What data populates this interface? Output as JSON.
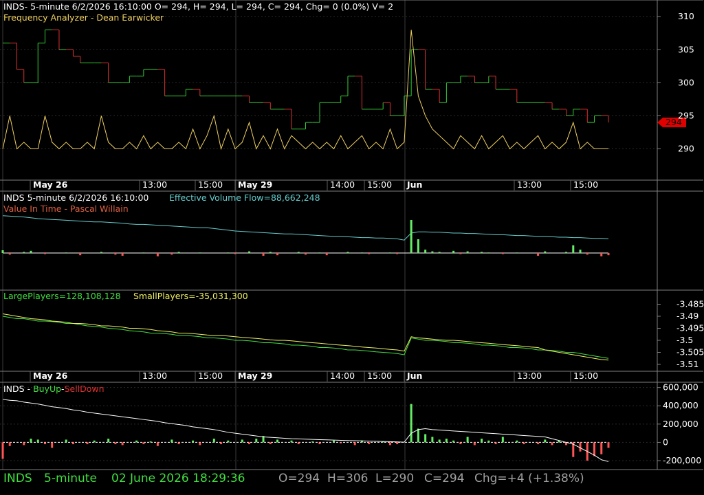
{
  "colors": {
    "bg": "#000000",
    "grid": "#2a2a2a",
    "border": "#808080",
    "text": "#ffffff",
    "up": "#33cc33",
    "down": "#e03030",
    "osc": "#f0d060",
    "cyan": "#66cccc",
    "green": "#40e040",
    "yellow": "#f0f060",
    "white": "#ffffff",
    "red_tag": "#e00000"
  },
  "header": {
    "price_line": "INDS- 5-minute 6/2/2026 16:10:00 O= 294, H= 294, L= 294, C= 294, Chg= 0 (0.0%) V= 2",
    "indicator": "Frequency Analyzer - Dean Earwicker"
  },
  "panel2": {
    "line1": "INDS 5-minute  6/2/2026 16:10:00",
    "evf": "Effective Volume Flow=88,662,248",
    "line2": "Value In Time - Pascal Willain"
  },
  "panel3": {
    "large": "LargePlayers=128,108,128",
    "small": "SmallPlayers=-35,031,300"
  },
  "panel4": {
    "title": "INDS - ",
    "buy": "BuyUp",
    "dash": "-",
    "sell": "SellDown"
  },
  "status": {
    "symbol": "INDS",
    "interval": "5-minute",
    "datetime": "02 June 2026 18:29:36",
    "o": "O=294",
    "h": "H=306",
    "l": "L=290",
    "c": "C=294",
    "chg": "Chg=+4 (+1.38%)"
  },
  "axis": {
    "time_labels": [
      "May 26",
      "13:00",
      "15:00",
      "May 29",
      "14:00",
      "15:00",
      "Jun",
      "13:00",
      "15:00"
    ],
    "time_bold": [
      true,
      false,
      false,
      true,
      false,
      false,
      true,
      false,
      false
    ]
  },
  "chart_data": [
    {
      "type": "line",
      "name": "price-step",
      "ylim": [
        286,
        312
      ],
      "yticks": [
        290,
        295,
        300,
        305,
        310
      ],
      "last_price": "294",
      "x_count": 87,
      "values": [
        306,
        306,
        302,
        300,
        300,
        306,
        308,
        308,
        305,
        305,
        304,
        303,
        303,
        303,
        303,
        300,
        300,
        300,
        301,
        301,
        302,
        302,
        302,
        298,
        298,
        298,
        299,
        299,
        298,
        298,
        298,
        298,
        298,
        298,
        298,
        297,
        297,
        297,
        296,
        296,
        296,
        293,
        293,
        294,
        294,
        297,
        297,
        297,
        298,
        301,
        301,
        296,
        296,
        296,
        297,
        295,
        295,
        298,
        305,
        305,
        299,
        299,
        297,
        300,
        300,
        301,
        301,
        300,
        300,
        301,
        299,
        299,
        299,
        297,
        297,
        297,
        297,
        297,
        296,
        296,
        295,
        296,
        296,
        294,
        295,
        295,
        294
      ]
    },
    {
      "type": "line",
      "name": "frequency-oscillator",
      "ylim": [
        286,
        312
      ],
      "values": [
        290,
        295,
        290,
        291,
        290,
        290,
        295,
        291,
        290,
        291,
        290,
        290,
        291,
        290,
        295,
        291,
        290,
        290,
        291,
        290,
        292,
        290,
        291,
        290,
        290,
        291,
        290,
        293,
        290,
        292,
        295,
        290,
        293,
        290,
        291,
        294,
        290,
        292,
        290,
        293,
        290,
        292,
        291,
        290,
        291,
        290,
        291,
        290,
        292,
        290,
        291,
        292,
        290,
        291,
        290,
        293,
        290,
        291,
        308,
        298,
        295,
        293,
        292,
        291,
        290,
        292,
        291,
        290,
        292,
        290,
        291,
        292,
        290,
        291,
        290,
        291,
        292,
        290,
        291,
        290,
        291,
        294,
        290,
        291,
        290,
        290,
        290
      ]
    },
    {
      "type": "line",
      "name": "effective-volume-flow",
      "values": [
        0.97,
        0.96,
        0.95,
        0.94,
        0.92,
        0.9,
        0.89,
        0.88,
        0.87,
        0.86,
        0.85,
        0.84,
        0.83,
        0.82,
        0.82,
        0.81,
        0.8,
        0.79,
        0.77,
        0.76,
        0.76,
        0.75,
        0.74,
        0.73,
        0.72,
        0.71,
        0.7,
        0.69,
        0.68,
        0.68,
        0.66,
        0.64,
        0.62,
        0.6,
        0.59,
        0.58,
        0.57,
        0.56,
        0.55,
        0.54,
        0.53,
        0.53,
        0.52,
        0.51,
        0.5,
        0.49,
        0.48,
        0.47,
        0.47,
        0.46,
        0.45,
        0.44,
        0.44,
        0.43,
        0.43,
        0.42,
        0.41,
        0.38,
        0.55,
        0.58,
        0.58,
        0.57,
        0.57,
        0.56,
        0.55,
        0.55,
        0.54,
        0.54,
        0.53,
        0.52,
        0.51,
        0.51,
        0.5,
        0.49,
        0.49,
        0.48,
        0.47,
        0.47,
        0.46,
        0.45,
        0.45,
        0.44,
        0.44,
        0.43,
        0.42,
        0.42,
        0.41
      ]
    },
    {
      "type": "bar",
      "name": "value-in-time-bars",
      "values": [
        0.5,
        -0.3,
        0,
        0.2,
        0.4,
        0,
        -0.2,
        0,
        0,
        0.1,
        0,
        -0.4,
        0,
        0,
        0.2,
        0,
        -0.3,
        -0.5,
        0,
        0,
        0.1,
        0,
        -0.6,
        0,
        -0.3,
        0.2,
        0,
        0,
        0.1,
        0,
        0,
        0,
        0.1,
        -0.2,
        0,
        0.3,
        0,
        -0.5,
        0.2,
        -0.4,
        0,
        0,
        0.2,
        -0.3,
        0,
        0.1,
        -0.4,
        0,
        0,
        0.2,
        0,
        0.1,
        -0.2,
        0,
        0,
        0.1,
        -0.2,
        0,
        6,
        2.5,
        0.6,
        0.3,
        0.2,
        0,
        0.4,
        -0.2,
        0.3,
        0,
        0.2,
        0.1,
        0,
        -0.2,
        0,
        0.1,
        0,
        0,
        -0.5,
        0.3,
        0,
        0,
        0.2,
        1.4,
        0.6,
        -0.3,
        0,
        -0.6,
        -0.4
      ]
    },
    {
      "type": "line",
      "name": "large-small-players",
      "ylim": [
        -3.512,
        -3.48
      ],
      "yticks": [
        -3.485,
        -3.49,
        -3.495,
        -3.5,
        -3.505,
        -3.51
      ],
      "series": [
        {
          "name": "LargePlayers",
          "color": "#40e040",
          "values": [
            -3.49,
            -3.4905,
            -3.491,
            -3.491,
            -3.4915,
            -3.492,
            -3.492,
            -3.4922,
            -3.4925,
            -3.493,
            -3.493,
            -3.4935,
            -3.494,
            -3.4942,
            -3.4945,
            -3.495,
            -3.4952,
            -3.4955,
            -3.496,
            -3.4962,
            -3.4965,
            -3.497,
            -3.497,
            -3.4972,
            -3.4975,
            -3.498,
            -3.498,
            -3.4982,
            -3.4985,
            -3.499,
            -3.499,
            -3.4992,
            -3.4995,
            -3.5,
            -3.5,
            -3.5002,
            -3.5005,
            -3.501,
            -3.501,
            -3.5012,
            -3.5015,
            -3.502,
            -3.502,
            -3.5022,
            -3.5025,
            -3.503,
            -3.503,
            -3.5032,
            -3.5035,
            -3.504,
            -3.504,
            -3.5042,
            -3.5045,
            -3.5048,
            -3.505,
            -3.5052,
            -3.5055,
            -3.506,
            -3.499,
            -3.4995,
            -3.5,
            -3.5,
            -3.5002,
            -3.5005,
            -3.501,
            -3.501,
            -3.5012,
            -3.5015,
            -3.502,
            -3.502,
            -3.5022,
            -3.5025,
            -3.503,
            -3.503,
            -3.5032,
            -3.5035,
            -3.504,
            -3.504,
            -3.5042,
            -3.5045,
            -3.505,
            -3.505,
            -3.5055,
            -3.506,
            -3.5065,
            -3.507,
            -3.5075
          ]
        },
        {
          "name": "SmallPlayers",
          "color": "#f0f060",
          "values": [
            -3.489,
            -3.4895,
            -3.49,
            -3.4905,
            -3.491,
            -3.4912,
            -3.4915,
            -3.492,
            -3.4922,
            -3.4925,
            -3.493,
            -3.493,
            -3.4932,
            -3.4935,
            -3.494,
            -3.494,
            -3.4942,
            -3.4945,
            -3.495,
            -3.495,
            -3.4952,
            -3.4955,
            -3.496,
            -3.4962,
            -3.4965,
            -3.497,
            -3.497,
            -3.4972,
            -3.4975,
            -3.4978,
            -3.498,
            -3.498,
            -3.4982,
            -3.4985,
            -3.4988,
            -3.499,
            -3.4992,
            -3.4995,
            -3.4998,
            -3.5,
            -3.5,
            -3.5002,
            -3.5005,
            -3.5008,
            -3.501,
            -3.5012,
            -3.5015,
            -3.5018,
            -3.502,
            -3.5022,
            -3.5025,
            -3.5028,
            -3.503,
            -3.5032,
            -3.5035,
            -3.5038,
            -3.504,
            -3.5045,
            -3.4985,
            -3.499,
            -3.4992,
            -3.4995,
            -3.4998,
            -3.5,
            -3.5,
            -3.5002,
            -3.5005,
            -3.5008,
            -3.501,
            -3.5012,
            -3.5015,
            -3.5018,
            -3.502,
            -3.5022,
            -3.5025,
            -3.5028,
            -3.503,
            -3.504,
            -3.5045,
            -3.505,
            -3.5055,
            -3.506,
            -3.5065,
            -3.507,
            -3.5075,
            -3.508,
            -3.5082
          ]
        }
      ]
    },
    {
      "type": "line",
      "name": "buyup-selldown",
      "ylim": [
        -290000,
        650000
      ],
      "yticks": [
        600000,
        400000,
        200000,
        0,
        -200000
      ],
      "ytick_labels": [
        "600,000",
        "400,000",
        "200,000",
        "0",
        "-200,000"
      ],
      "line": [
        470000,
        460000,
        455000,
        440000,
        430000,
        420000,
        405000,
        390000,
        380000,
        370000,
        355000,
        345000,
        330000,
        320000,
        310000,
        300000,
        290000,
        280000,
        270000,
        260000,
        250000,
        240000,
        230000,
        215000,
        205000,
        195000,
        185000,
        170000,
        160000,
        150000,
        140000,
        125000,
        110000,
        100000,
        90000,
        80000,
        70000,
        60000,
        55000,
        50000,
        45000,
        40000,
        38000,
        35000,
        32000,
        30000,
        28000,
        25000,
        22000,
        20000,
        18000,
        16000,
        14000,
        12000,
        10000,
        8000,
        5000,
        2000,
        100000,
        140000,
        150000,
        140000,
        135000,
        130000,
        125000,
        120000,
        115000,
        110000,
        105000,
        100000,
        95000,
        90000,
        85000,
        80000,
        75000,
        70000,
        65000,
        60000,
        40000,
        20000,
        0,
        -20000,
        -60000,
        -100000,
        -140000,
        -190000,
        -210000
      ],
      "bars": [
        -180000,
        -40000,
        0,
        -30000,
        40000,
        30000,
        -20000,
        -60000,
        0,
        30000,
        -20000,
        0,
        -20000,
        20000,
        0,
        40000,
        -20000,
        -30000,
        0,
        20000,
        -20000,
        10000,
        -40000,
        0,
        30000,
        -20000,
        0,
        20000,
        -30000,
        0,
        40000,
        -20000,
        20000,
        0,
        30000,
        -20000,
        40000,
        70000,
        -20000,
        30000,
        0,
        20000,
        -20000,
        0,
        10000,
        -20000,
        0,
        20000,
        -10000,
        0,
        -30000,
        20000,
        -20000,
        0,
        10000,
        -30000,
        -20000,
        0,
        420000,
        150000,
        90000,
        60000,
        30000,
        40000,
        20000,
        -20000,
        60000,
        -30000,
        40000,
        20000,
        -20000,
        60000,
        0,
        20000,
        -20000,
        0,
        -20000,
        30000,
        -30000,
        20000,
        -30000,
        -160000,
        -100000,
        -200000,
        -150000,
        -130000,
        -60000
      ]
    }
  ]
}
